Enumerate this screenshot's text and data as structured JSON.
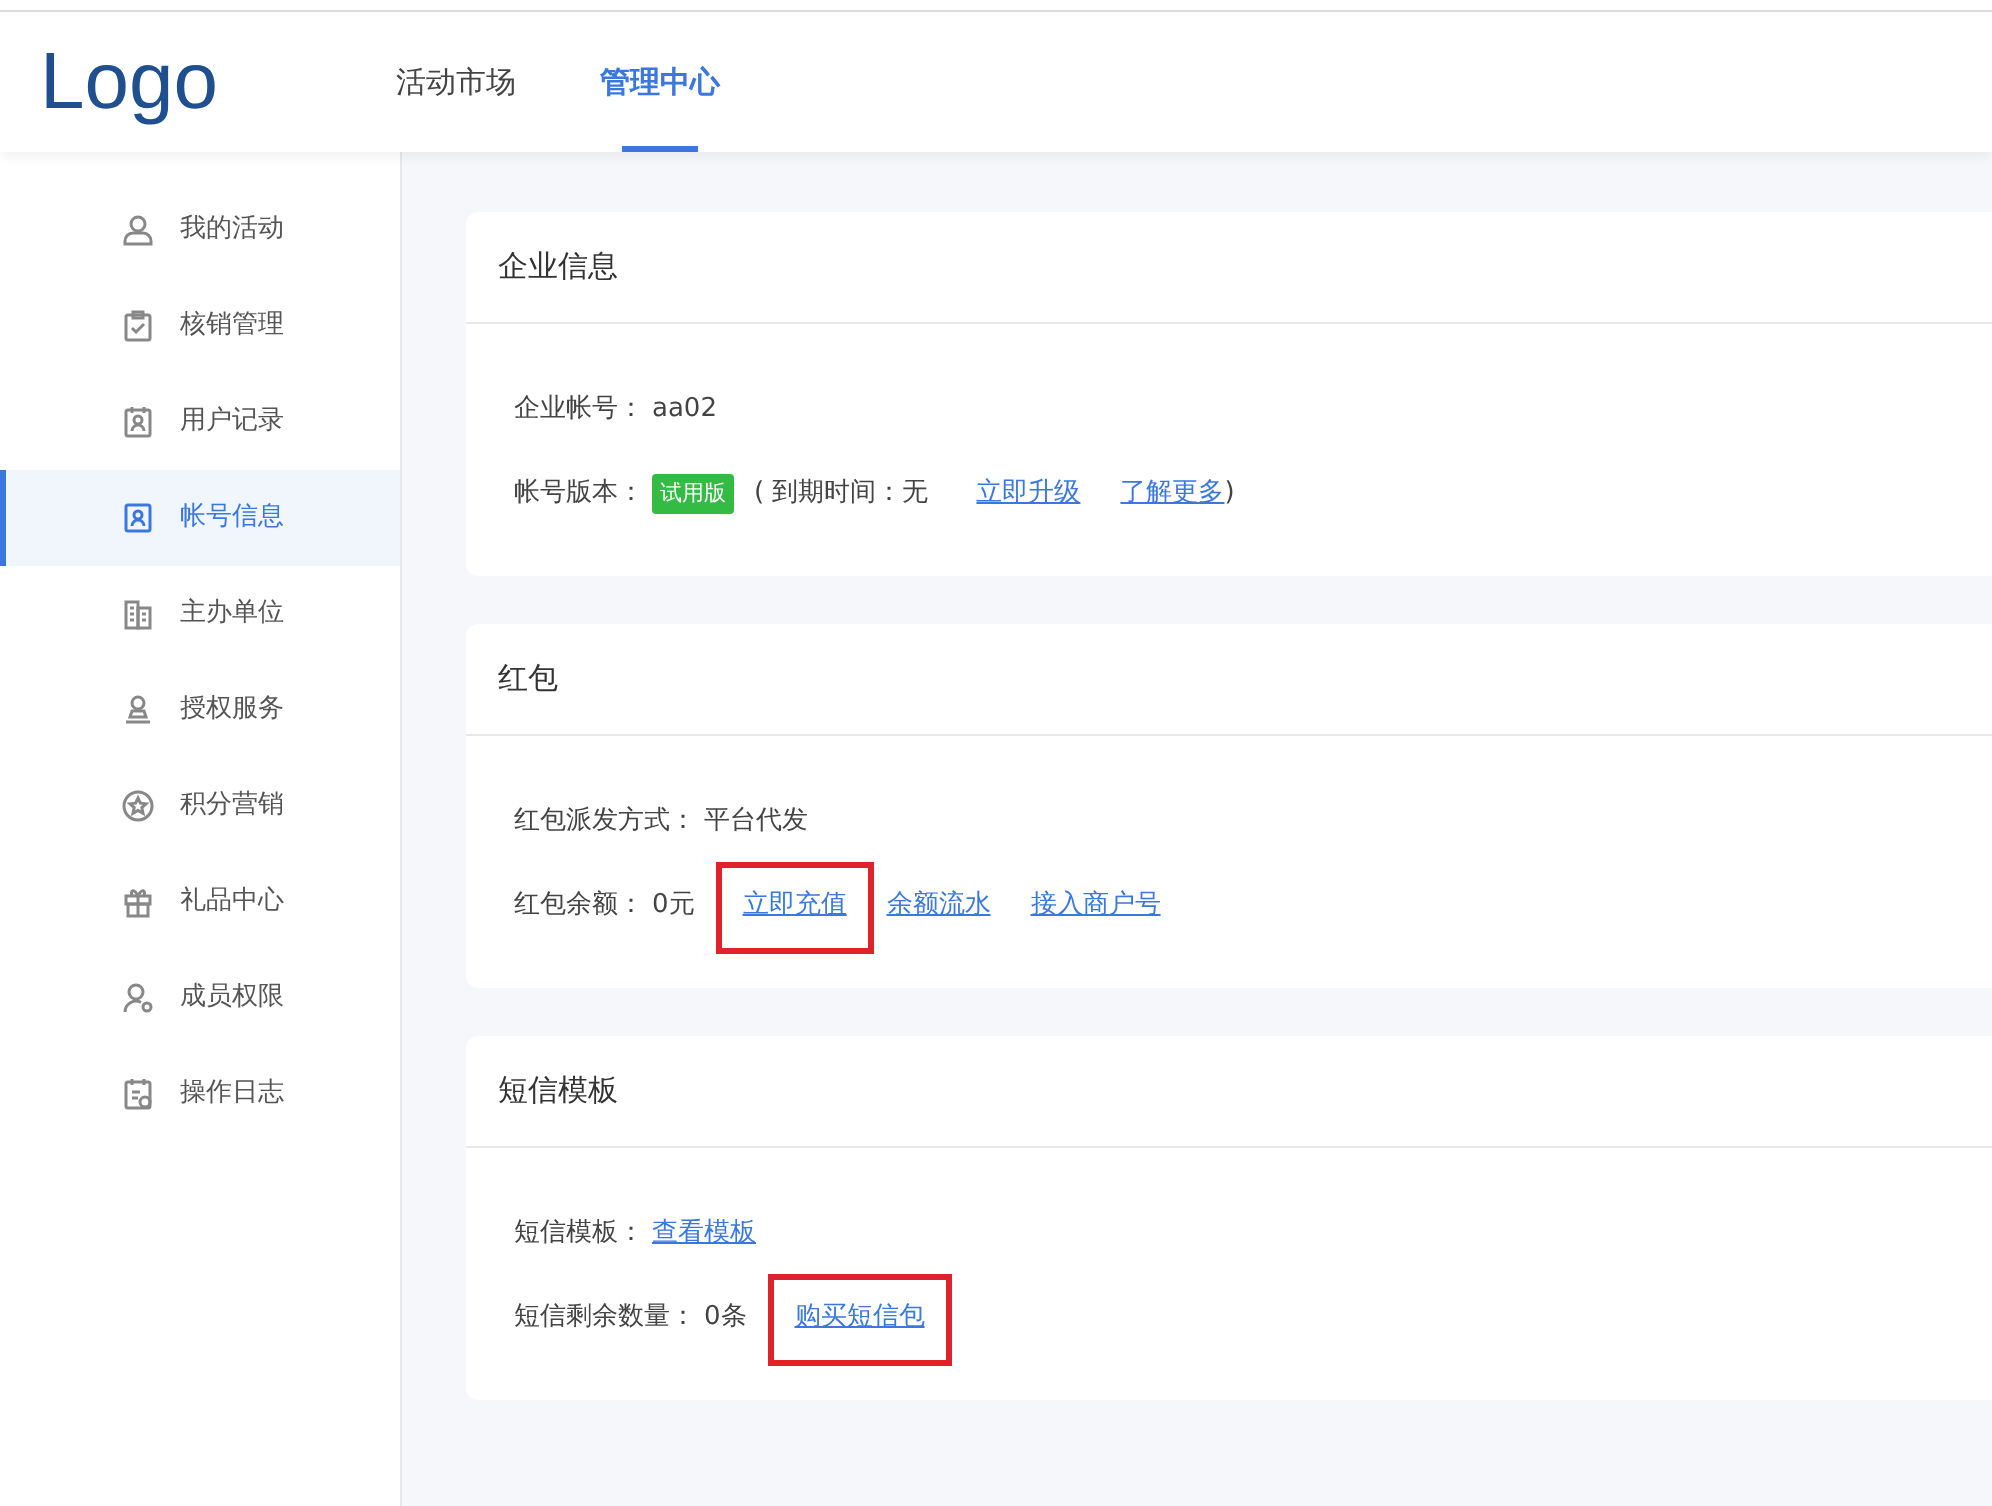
{
  "header": {
    "logo": "Logo",
    "nav": [
      {
        "label": "活动市场",
        "selected": false
      },
      {
        "label": "管理中心",
        "selected": true
      }
    ]
  },
  "sidebar": {
    "items": [
      {
        "label": "我的活动",
        "selected": false
      },
      {
        "label": "核销管理",
        "selected": false
      },
      {
        "label": "用户记录",
        "selected": false
      },
      {
        "label": "帐号信息",
        "selected": true
      },
      {
        "label": "主办单位",
        "selected": false
      },
      {
        "label": "授权服务",
        "selected": false
      },
      {
        "label": "积分营销",
        "selected": false
      },
      {
        "label": "礼品中心",
        "selected": false
      },
      {
        "label": "成员权限",
        "selected": false
      },
      {
        "label": "操作日志",
        "selected": false
      }
    ]
  },
  "sections": [
    {
      "title": "企业信息",
      "fields": [
        {
          "label": "企业帐号：",
          "parts": [
            {
              "kind": "text",
              "text": "aa02"
            }
          ]
        },
        {
          "label": "帐号版本：",
          "parts": [
            {
              "kind": "badge",
              "text": "试用版"
            },
            {
              "kind": "text",
              "text": "(  到期时间：无"
            },
            {
              "kind": "link",
              "text": "立即升级",
              "highlighted": false
            },
            {
              "kind": "link",
              "text": "了解更多",
              "highlighted": false
            },
            {
              "kind": "text",
              "text": ")"
            }
          ]
        }
      ]
    },
    {
      "title": "红包",
      "fields": [
        {
          "label": "红包派发方式：",
          "parts": [
            {
              "kind": "text",
              "text": "平台代发"
            }
          ]
        },
        {
          "label": "红包余额：",
          "parts": [
            {
              "kind": "text",
              "text": "0元"
            },
            {
              "kind": "link",
              "text": "立即充值",
              "highlighted": true
            },
            {
              "kind": "link",
              "text": "余额流水",
              "highlighted": false
            },
            {
              "kind": "link",
              "text": "接入商户号",
              "highlighted": false
            }
          ]
        }
      ]
    },
    {
      "title": "短信模板",
      "fields": [
        {
          "label": "短信模板：",
          "parts": [
            {
              "kind": "link",
              "text": "查看模板",
              "highlighted": false
            }
          ]
        },
        {
          "label": "短信剩余数量：",
          "parts": [
            {
              "kind": "text",
              "text": "0条"
            },
            {
              "kind": "link",
              "text": "购买短信包",
              "highlighted": true
            }
          ]
        }
      ]
    }
  ]
}
